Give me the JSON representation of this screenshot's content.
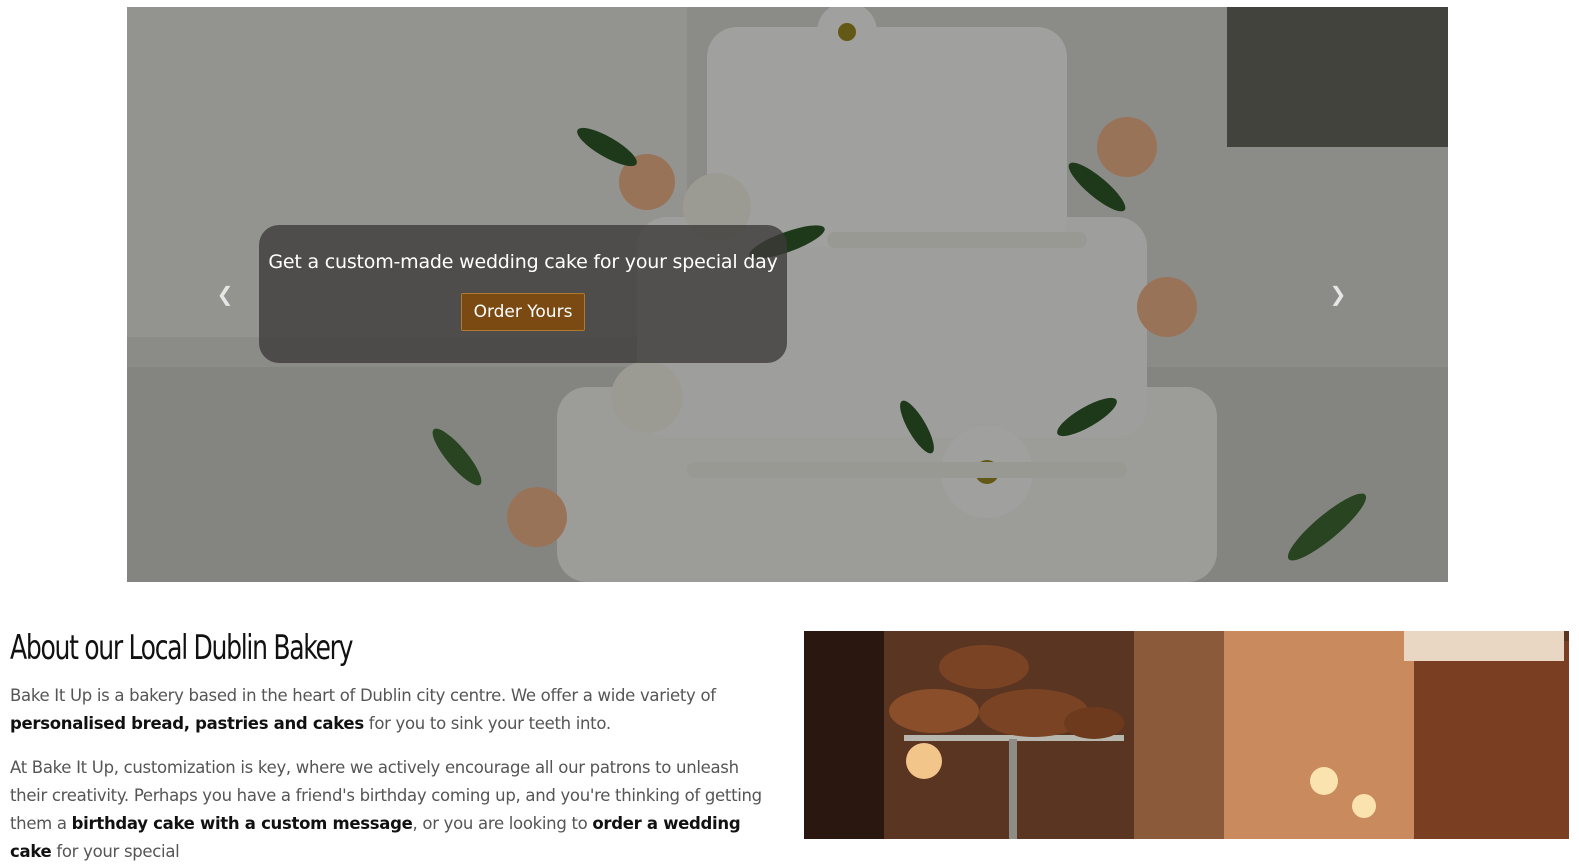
{
  "carousel": {
    "caption": "Get a custom-made wedding cake for your special day",
    "button_label": "Order Yours",
    "prev_icon": "chevron-left-icon",
    "next_icon": "chevron-right-icon",
    "prev_glyph": "❮",
    "next_glyph": "❯"
  },
  "about": {
    "heading": "About our Local Dublin Bakery",
    "p1_start": "Bake It Up is a bakery based in the heart of Dublin city centre. We offer a wide variety of ",
    "p1_bold": "personalised bread, pastries and cakes",
    "p1_end": " for you to sink your teeth into.",
    "p2_start": "At Bake It Up, customization is key, where we actively encourage all our patrons to unleash their creativity. Perhaps you have a friend's birthday coming up, and you're thinking of getting them a ",
    "p2_bold1": "birthday cake with a custom message",
    "p2_mid": ", or you are looking to ",
    "p2_bold2": "order a wedding cake",
    "p2_end": " for your special"
  },
  "colors": {
    "accent_button": "#7a4a12",
    "caption_bg": "#3c3a38",
    "heading": "#111111",
    "body_text": "#555555"
  }
}
